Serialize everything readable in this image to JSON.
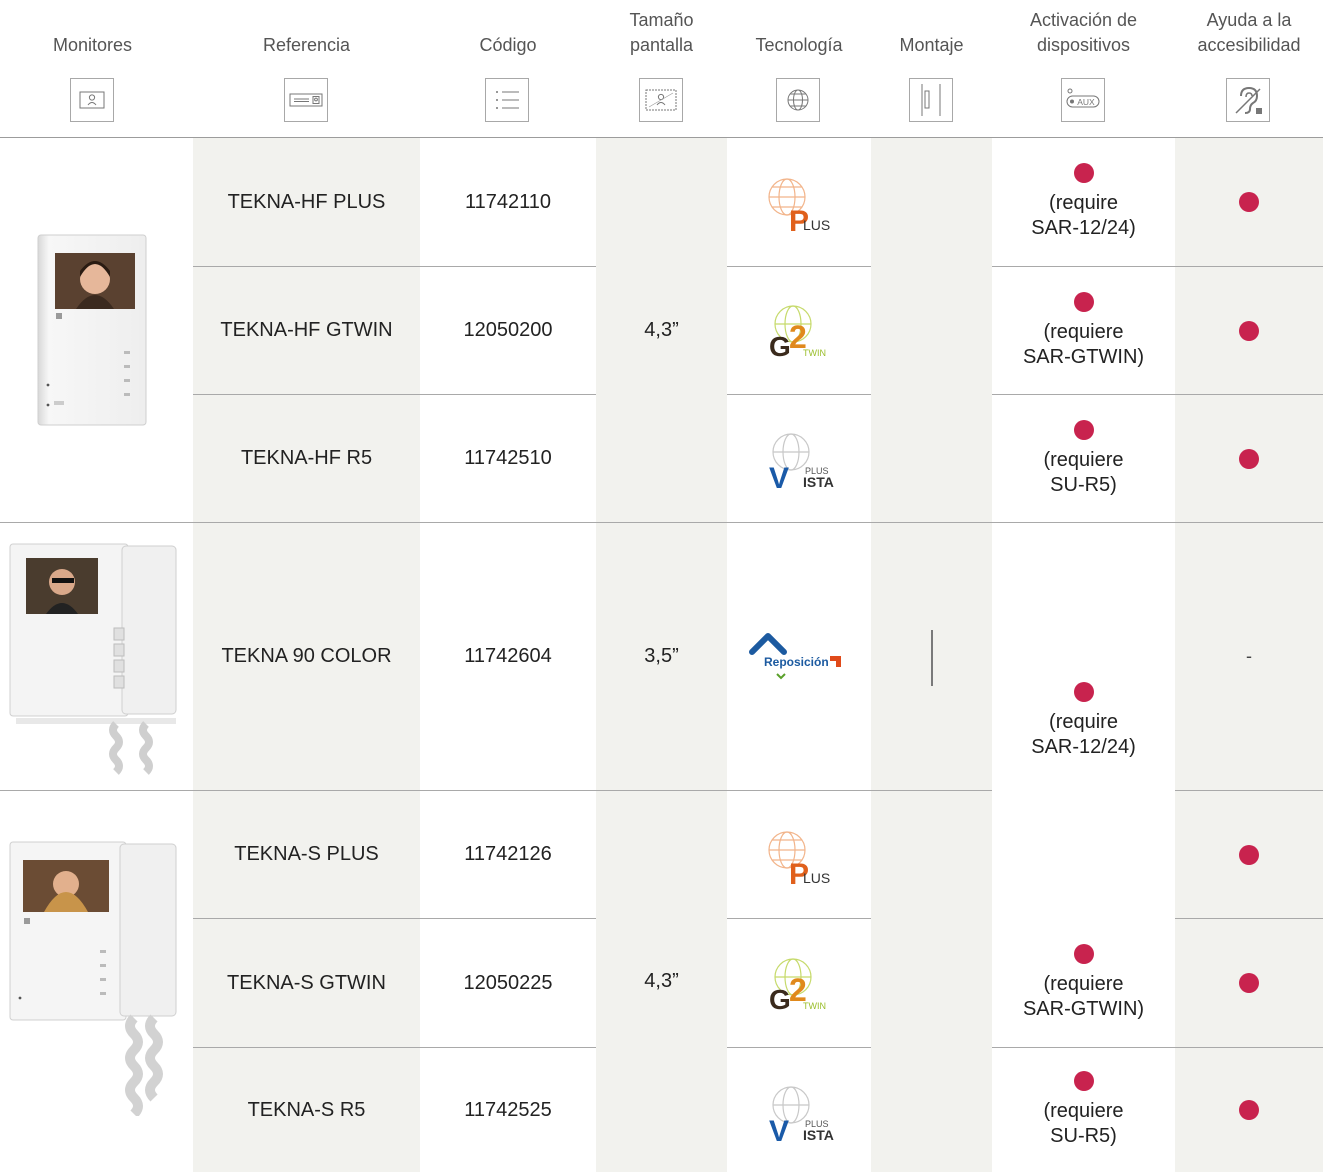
{
  "colors": {
    "accent_dot": "#c8234e",
    "shade": "#f2f2ee"
  },
  "headers": [
    {
      "label": "Monitores",
      "icon": "monitor-icon"
    },
    {
      "label": "Referencia",
      "icon": "panel-icon"
    },
    {
      "label": "Código",
      "icon": "list-icon"
    },
    {
      "label": "Tamaño pantalla",
      "icon": "screen-size-icon"
    },
    {
      "label": "Tecnología",
      "icon": "globe-icon"
    },
    {
      "label": "Montaje",
      "icon": "mount-icon"
    },
    {
      "label": "Activación de dispositivos",
      "icon": "aux-icon"
    },
    {
      "label": "Ayuda a la accesibilidad",
      "icon": "hearing-loop-icon"
    }
  ],
  "aux_icon_text": "AUX",
  "rows": [
    {
      "reference": "TEKNA-HF PLUS",
      "code": "11742110",
      "tech": "PLUS",
      "activation_note": "(require SAR-12/24)"
    },
    {
      "reference": "TEKNA-HF GTWIN",
      "code": "12050200",
      "tech": "G2TWIN",
      "activation_note": "(requiere SAR-GTWIN)"
    },
    {
      "reference": "TEKNA-HF R5",
      "code": "11742510",
      "tech": "VISTA PLUS",
      "activation_note": "(requiere SU-R5)"
    },
    {
      "reference": "TEKNA 90 COLOR",
      "code": "11742604",
      "tech": "Reposición",
      "accessibility": "-"
    },
    {
      "reference": "TEKNA-S PLUS",
      "code": "11742126",
      "tech": "PLUS"
    },
    {
      "reference": "TEKNA-S GTWIN",
      "code": "12050225",
      "tech": "G2TWIN",
      "activation_note": "(requiere SAR-GTWIN)"
    },
    {
      "reference": "TEKNA-S R5",
      "code": "11742525",
      "tech": "VISTA PLUS",
      "activation_note": "(requiere SU-R5)"
    }
  ],
  "shared_activation_note": "(require SAR-12/24)",
  "screen_sizes": [
    "4,3”",
    "3,5”",
    "4,3”"
  ],
  "logos": {
    "plus": {
      "letter": "P",
      "rest": "LUS"
    },
    "g2twin": {
      "g": "G",
      "two": "2",
      "twin": "TWIN"
    },
    "vista": {
      "v": "V",
      "small": "PLUS",
      "rest": "ISTA"
    },
    "reposicion": {
      "text": "Reposición"
    }
  }
}
